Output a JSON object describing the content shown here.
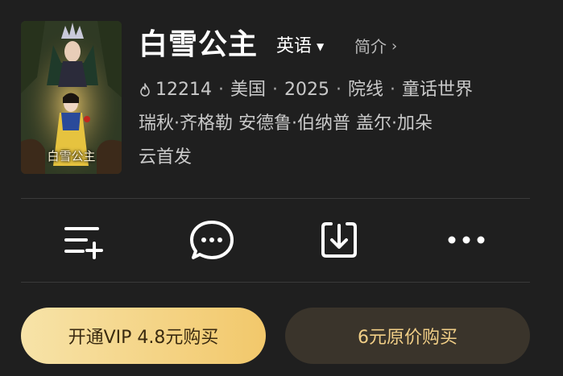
{
  "movie": {
    "poster_title": "白雪公主",
    "title": "白雪公主",
    "language": "英语",
    "intro_label": "简介",
    "heat": "12214",
    "meta_items": [
      "美国",
      "2025",
      "院线",
      "童话世界"
    ],
    "cast": "瑞秋·齐格勒 安德鲁·伯纳普 盖尔·加朵",
    "release_note": "云首发"
  },
  "actions": [
    {
      "icon": "add-to-list-icon"
    },
    {
      "icon": "comment-icon"
    },
    {
      "icon": "download-icon"
    },
    {
      "icon": "more-icon"
    }
  ],
  "buttons": {
    "vip_label": "开通VIP 4.8元购买",
    "original_label": "6元原价购买"
  },
  "colors": {
    "background": "#1f1f1f",
    "vip_gradient_start": "#f7e3a8",
    "vip_gradient_end": "#f2c86b",
    "vip_text": "#3a2a10",
    "original_bg": "#3a342b",
    "original_text": "#f2cf87"
  }
}
